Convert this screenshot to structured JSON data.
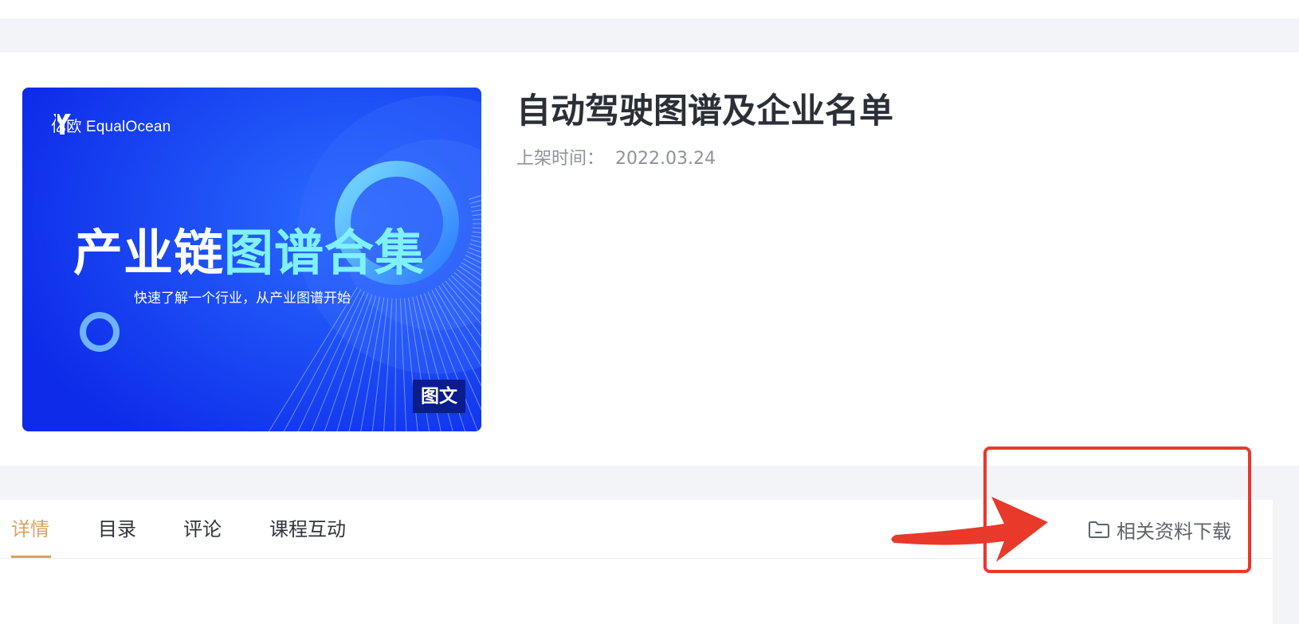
{
  "course": {
    "title": "自动驾驶图谱及企业名单",
    "listed_label": "上架时间：",
    "listed_date": "2022.03.24"
  },
  "cover": {
    "brand_name": "亿欧 EqualOcean",
    "title_plain": "产业链",
    "title_highlight": "图谱合集",
    "subtitle": "快速了解一个行业，从产业图谱开始",
    "badge": "图文",
    "colors": {
      "background": "#0f2ef0",
      "highlight": "#7ff2ff"
    }
  },
  "tabs": {
    "items": [
      {
        "label": "详情",
        "active": true
      },
      {
        "label": "目录",
        "active": false
      },
      {
        "label": "评论",
        "active": false
      },
      {
        "label": "课程互动",
        "active": false
      }
    ],
    "download_label": "相关资料下载",
    "download_icon": "folder-icon"
  },
  "colors": {
    "accent": "#d7a55e",
    "annotation": "#e8392b",
    "page_band": "#f3f4f8"
  }
}
